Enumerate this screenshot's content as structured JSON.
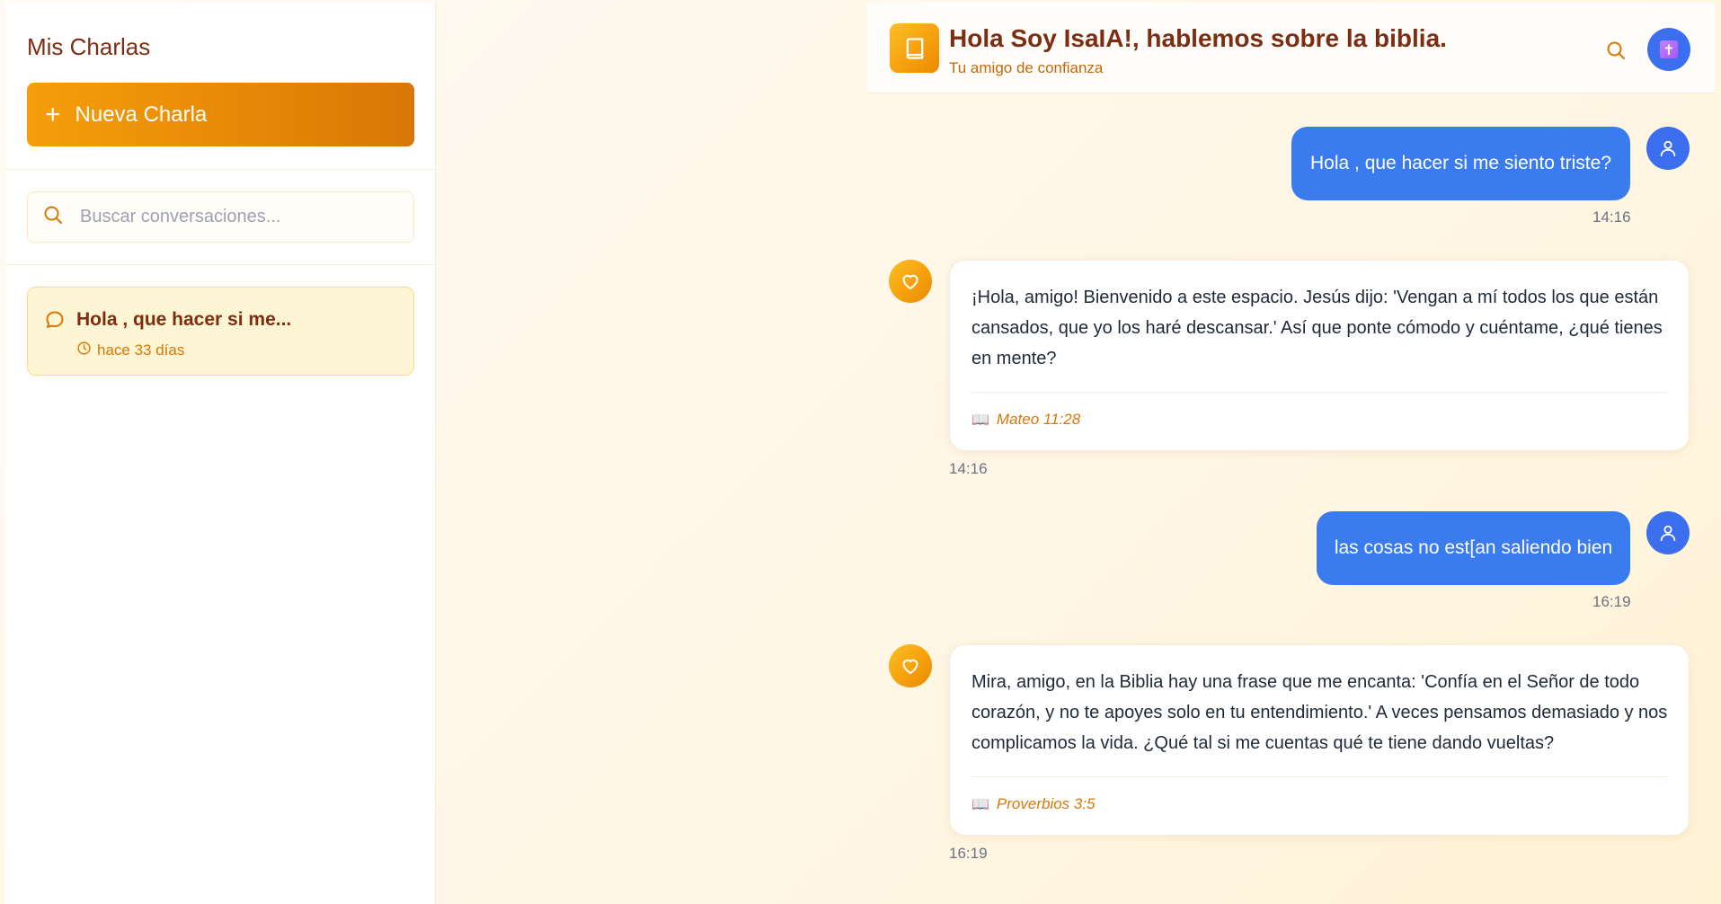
{
  "sidebar": {
    "title": "Mis Charlas",
    "new_chat_label": "Nueva Charla",
    "search_placeholder": "Buscar conversaciones...",
    "conversations": [
      {
        "title": "Hola , que hacer si me...",
        "meta": "hace 33 días"
      }
    ]
  },
  "header": {
    "title": "Hola Soy IsaIA!, hablemos sobre la biblia.",
    "subtitle": "Tu amigo de confianza",
    "icons": {
      "logo": "book-icon",
      "search": "search-icon",
      "avatar": "cross-avatar"
    }
  },
  "messages": [
    {
      "role": "user",
      "text": "Hola , que hacer si me siento triste?",
      "time": "14:16"
    },
    {
      "role": "bot",
      "text": "¡Hola, amigo! Bienvenido a este espacio. Jesús dijo: 'Vengan a mí todos los que están cansados, que yo los haré descansar.' Así que ponte cómodo y cuéntame, ¿qué tienes en mente?",
      "reference": "Mateo 11:28",
      "time": "14:16"
    },
    {
      "role": "user",
      "text": "las cosas no est[an saliendo bien",
      "time": "16:19"
    },
    {
      "role": "bot",
      "text": "Mira, amigo, en la Biblia hay una frase que me encanta: 'Confía en el Señor de todo corazón, y no te apoyes solo en tu entendimiento.' A veces pensamos demasiado y nos complicamos la vida. ¿Qué tal si me cuentas qué te tiene dando vueltas?",
      "reference": "Proverbios 3:5",
      "time": "16:19"
    }
  ],
  "colors": {
    "accent": "#f59e0b",
    "user_bubble": "#3b7bf0",
    "title_brown": "#7c2d12"
  }
}
